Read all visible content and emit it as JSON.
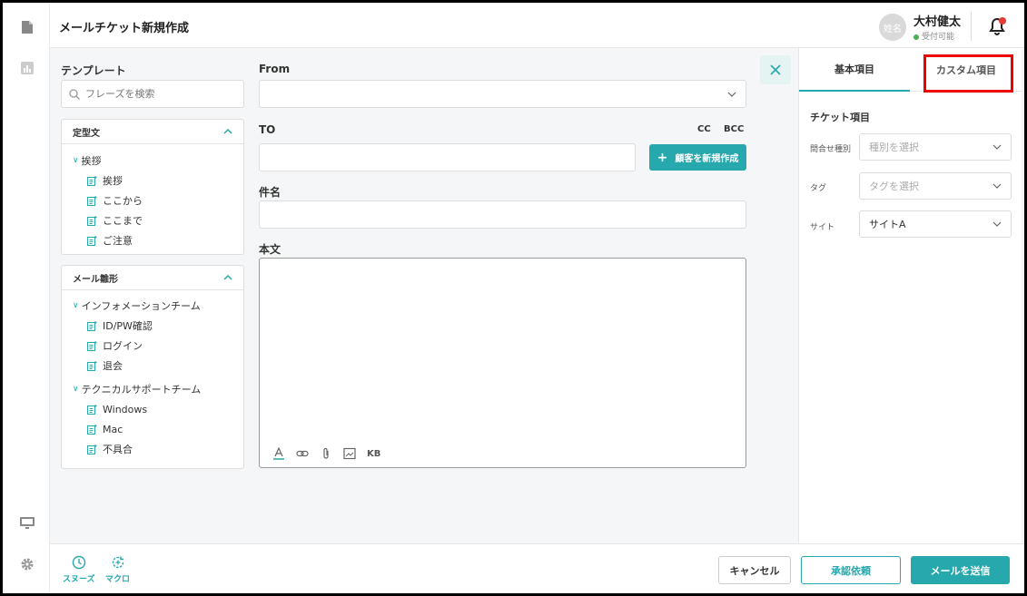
{
  "header": {
    "title": "メールチケット新規作成",
    "avatar_text": "姓名",
    "user_name": "大村健太",
    "user_status": "受付可能"
  },
  "template": {
    "title": "テンプレート",
    "search_placeholder": "フレーズを検索",
    "groups": [
      {
        "title": "定型文",
        "folders": [
          {
            "label": "挨拶",
            "items": [
              "挨拶",
              "ここから",
              "ここまで",
              "ご注意"
            ]
          }
        ]
      },
      {
        "title": "メール雛形",
        "folders": [
          {
            "label": "インフォメーションチーム",
            "items": [
              "ID/PW確認",
              "ログイン",
              "退会"
            ]
          },
          {
            "label": "テクニカルサポートチーム",
            "items": [
              "Windows",
              "Mac",
              "不具合"
            ]
          }
        ]
      }
    ]
  },
  "form": {
    "from_label": "From",
    "to_label": "TO",
    "cc_label": "CC",
    "bcc_label": "BCC",
    "new_customer_button": "顧客を新規作成",
    "subject_label": "件名",
    "body_label": "本文",
    "kb_label": "KB"
  },
  "right_panel": {
    "tabs": [
      "基本項目",
      "カスタム項目"
    ],
    "section_title": "チケット項目",
    "fields": [
      {
        "label": "問合せ種別",
        "value": "",
        "placeholder": "種別を選択"
      },
      {
        "label": "タグ",
        "value": "",
        "placeholder": "タグを選択"
      },
      {
        "label": "サイト",
        "value": "サイトA",
        "placeholder": ""
      }
    ]
  },
  "bottom": {
    "snooze_label": "スヌーズ",
    "macro_label": "マクロ",
    "cancel_button": "キャンセル",
    "approve_button": "承認依頼",
    "send_button": "メールを送信"
  },
  "colors": {
    "accent": "#26a8ac",
    "highlight": "#e00000",
    "notification": "#e53935"
  }
}
